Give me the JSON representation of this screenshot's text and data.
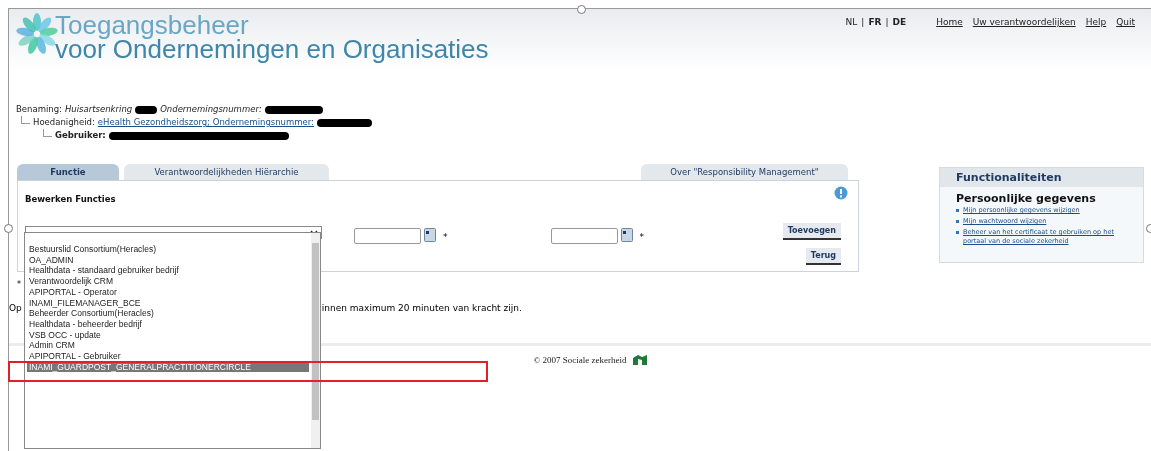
{
  "header": {
    "title_line1": "Toegangsbeheer",
    "title_line2": "voor Ondernemingen en Organisaties",
    "languages": [
      {
        "label": "NL",
        "bold": false
      },
      {
        "label": "FR",
        "bold": true
      },
      {
        "label": "DE",
        "bold": true
      }
    ],
    "separator": "|",
    "links": [
      "Home",
      "Uw verantwoordelijken",
      "Help",
      "Quit"
    ]
  },
  "entity": {
    "benaming_label": "Benaming:",
    "benaming_value": "Huisartsenkring",
    "number_label": "Ondernemingsnummer:",
    "hoedanigheid_label": "Hoedanigheid:",
    "hoedanigheid_link": "eHealth Gezondheidszorg; Ondernemingsnummer:",
    "user_label": "Gebruiker:"
  },
  "tabs": [
    {
      "label": "Functie",
      "selected": true
    },
    {
      "label": "Verantwoordelijkheden Hiërarchie",
      "selected": false
    },
    {
      "label": "Over \"Responsibility Management\"",
      "selected": false
    }
  ],
  "panel": {
    "title": "Bewerken Functies",
    "required_mark": "*",
    "buttons": [
      "Toevoegen",
      "Terug"
    ]
  },
  "dropdown_options": [
    {
      "label": "Bestuurslid Consortium(Heracles)",
      "selected": false
    },
    {
      "label": "OA_ADMIN",
      "selected": false
    },
    {
      "label": "Healthdata - standaard gebruiker bedrijf",
      "selected": false
    },
    {
      "label": "Verantwoordelijk CRM",
      "selected": false
    },
    {
      "label": "APIPORTAL - Operator",
      "selected": false
    },
    {
      "label": "INAMI_FILEMANAGER_BCE",
      "selected": false
    },
    {
      "label": "Beheerder Consortium(Heracles)",
      "selected": false
    },
    {
      "label": "Healthdata - beheerder bedrijf",
      "selected": false
    },
    {
      "label": "VSB OCC - update",
      "selected": false
    },
    {
      "label": "Admin CRM",
      "selected": false
    },
    {
      "label": "APIPORTAL - Gebruiker",
      "selected": false
    },
    {
      "label": "INAMI_GUARDPOST_GENERALPRACTITIONERCIRCLE",
      "selected": true
    }
  ],
  "notes": {
    "asterisk": "*",
    "start": "Op",
    "end": "innen maximum 20 minuten van kracht zijn."
  },
  "footer": {
    "copyright": "© 2007 Sociale zekerheid"
  },
  "sidebar": {
    "title": "Functionaliteiten",
    "section": "Persoonlijke gegevens",
    "links": [
      "Mijn persoonlijke gegevens wijzigen",
      "Mijn wachtwoord wijzigen",
      "Beheer van het certificaat te gebruiken op het portaal van de sociale zekerheid"
    ]
  }
}
